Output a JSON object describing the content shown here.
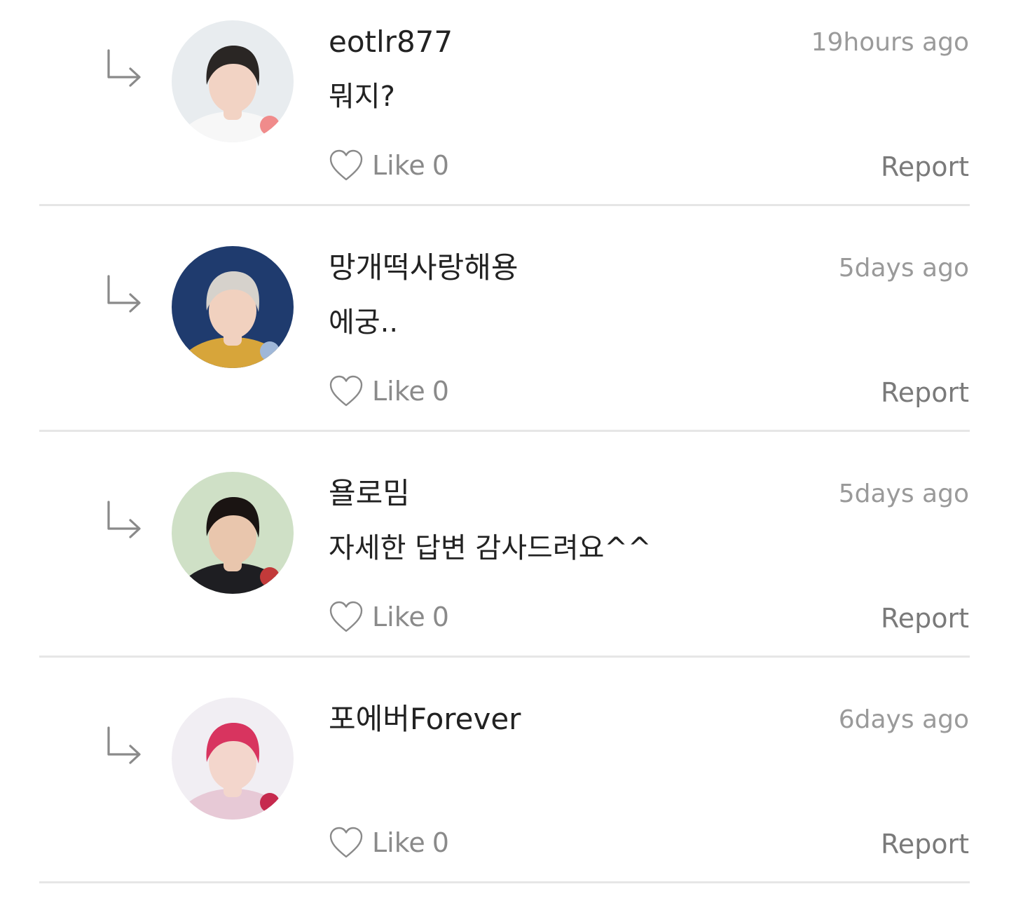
{
  "comments": [
    {
      "username": "eotlr877",
      "time": "19hours ago",
      "text": "뭐지?",
      "like_label": "Like",
      "like_count": "0",
      "report_label": "Report",
      "avatar_colors": {
        "bg": "#e8ecef",
        "hair": "#2a2624",
        "skin": "#f2d3c4",
        "cloth": "#f7f7f7",
        "accent": "#f08b8b"
      }
    },
    {
      "username": "망개떡사랑해용",
      "time": "5days ago",
      "text": "에궁..",
      "like_label": "Like",
      "like_count": "0",
      "report_label": "Report",
      "avatar_colors": {
        "bg": "#1f3b6e",
        "hair": "#d6d2cc",
        "skin": "#f1d1bf",
        "cloth": "#d7a53a",
        "accent": "#9fb7d8"
      }
    },
    {
      "username": "욜로밈",
      "time": "5days ago",
      "text": "자세한 답변 감사드려요^^",
      "like_label": "Like",
      "like_count": "0",
      "report_label": "Report",
      "avatar_colors": {
        "bg": "#cfe0c6",
        "hair": "#1a1412",
        "skin": "#e9c6ad",
        "cloth": "#1e1e22",
        "accent": "#c23a3a"
      }
    },
    {
      "username": "포에버Forever",
      "time": "6days ago",
      "text": "",
      "like_label": "Like",
      "like_count": "0",
      "report_label": "Report",
      "avatar_colors": {
        "bg": "#f1eef3",
        "hair": "#d8345f",
        "skin": "#f3d6cc",
        "cloth": "#e7c9d6",
        "accent": "#c62a4e"
      }
    }
  ],
  "icons": {
    "reply": "reply-arrow-icon",
    "like": "heart-outline-icon"
  },
  "colors": {
    "text_primary": "#222222",
    "text_secondary": "#9a9a9a",
    "divider": "#e6e6e6"
  }
}
